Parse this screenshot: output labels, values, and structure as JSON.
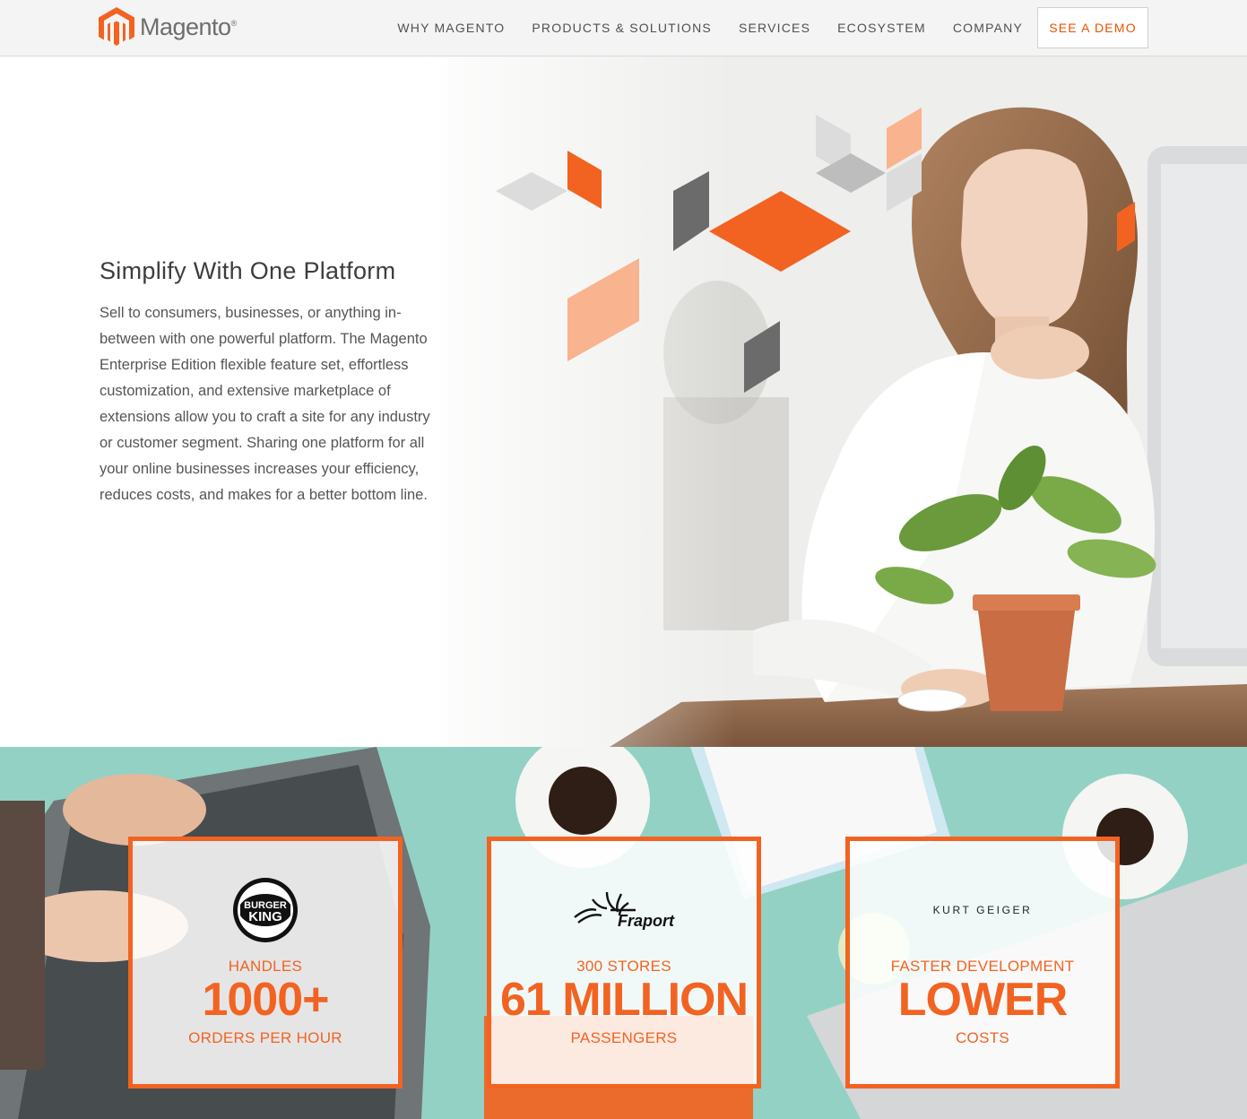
{
  "header": {
    "logo_text": "Magento",
    "logo_mark": "®",
    "nav": [
      "WHY MAGENTO",
      "PRODUCTS & SOLUTIONS",
      "SERVICES",
      "ECOSYSTEM",
      "COMPANY"
    ],
    "cta": "SEE A DEMO"
  },
  "hero": {
    "title": "Simplify With One Platform",
    "body": "Sell to consumers, businesses, or anything in-between with one powerful platform. The Magento Enterprise Edition flexible feature set, effortless customization, and extensive marketplace of extensions allow you to craft a site for any industry or customer segment. Sharing one platform for all your online businesses increases your efficiency, reduces costs, and makes for a better bottom line."
  },
  "stats": [
    {
      "logo": "burger-king-logo",
      "top": "HANDLES",
      "big": "1000+",
      "bottom": "ORDERS PER HOUR"
    },
    {
      "logo": "fraport-logo",
      "logo_text": "Fraport",
      "top": "300 STORES",
      "big": "61 MILLION",
      "bottom": "PASSENGERS"
    },
    {
      "logo": "kurt-geiger-logo",
      "logo_text": "KURT GEIGER",
      "top": "FASTER DEVELOPMENT",
      "big": "LOWER",
      "bottom": "COSTS"
    }
  ],
  "colors": {
    "accent": "#f26322",
    "cta_text": "#eb5202",
    "header_bg": "#f4f4f4",
    "stats_bg": "#8fcfc3"
  }
}
